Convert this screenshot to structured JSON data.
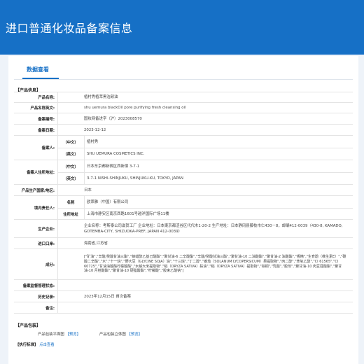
{
  "header": {
    "title": "进口普通化妆品备案信息"
  },
  "tab": {
    "label": "数据查看"
  },
  "product_info": {
    "section_label": "【产品信息】",
    "rows": {
      "name_cn": {
        "label": "产品名称:",
        "value": "植村秀植萃黑洁颜油"
      },
      "name_en": {
        "label": "产品名称英文:",
        "value": "shu uemura blackOil pore purifying fresh cleansing oil"
      },
      "record_no": {
        "label": "备案编号:",
        "value": "国妆网备进字（沪）2023008570"
      },
      "record_date": {
        "label": "备案日期:",
        "value": "2023-12-12"
      },
      "filer": {
        "label": "备案人:",
        "sub_cn": "（中文）",
        "value_cn": "植村秀",
        "sub_en": "（英文）",
        "value_en": "SHU UEMURA COSMETICS INC."
      },
      "filer_address": {
        "label": "备案人住所地址:",
        "sub_cn": "（中文）",
        "value_cn": "日本东京都新宿区西新宿 3-7-1",
        "sub_en": "（英文）",
        "value_en": "3-7-1 NISHI-SHINJUKU, SHINJUKU-KU, TOKYO, JAPAN"
      },
      "origin": {
        "label": "产品生产国家/地区:",
        "value": "日本"
      },
      "domestic_agent": {
        "label": "境内责任人:",
        "sub_name": "名称",
        "value_name": "欧莱雅（中国）有限公司",
        "sub_address": "住所地址",
        "value_address": "上海市静安区南京西路1601号越洋国际广场11楼"
      },
      "producer": {
        "label": "生产企业:",
        "value": "企业名称：考斯泰公司滋贺工厂 企业地址：日本東京都涩谷区代代木1-20-2 生产地址：日本静冈县藤枝市仁430－8，邮编412-0039（430-8, KAMADO, GOTEMBA-CITY, SHIZUOKA-PREF, JAPAN 412-0039）"
      },
      "port": {
        "label": "进口口岸:",
        "value": "海南省,江苏省"
      },
      "ingredients": {
        "label": "成分:",
        "value": "[\"矿油\",\"辛酸/癸酸甘油三酯\",\"鲸蜡醇乙基己酸酯\",\"聚甘油-6 二辛酸酯\",\"辛酸/癸酸甘油三酯\",\"聚甘油-10 二油酸酯\",\"聚甘油-2 油酸酯\",\"香精\",\"生育酚（维生素E）\",\"碳酸二辛酯\",\"水\",\"十一烷\",\"野大豆（GLYCINE SOJA）油\",\"十三烷\",\"丁二醇\",\"番茄（SOLANUM LYCOPERSICUM）果提取物\",\"丙二醇\",\"苯氧乙醇\",\"CI 61565\",\"CI 60725\",\"甘油油酸酯柠檬酸酯\",\"水解大米提取物\",\"稻（ORYZA SATIVA）麸油\",\"稻（ORYZA SATIVA）提取物\",\"棕榈\",\"乳酸\",\"胶剂\",\"聚甘油-10 肉豆蔻酸酯\",\"聚甘油-10 月桂酸酯\",\"聚甘油-10 硬脂酸酯\",\"柠檬酸\",\"胶束乙酸钠\"]"
      },
      "inspection": {
        "label": "备案监督管理状态:",
        "value": ""
      },
      "history": {
        "label": "历史记录:",
        "value": "2023年12月15日 首次备案"
      },
      "remarks": {
        "label": "备注:",
        "value": ""
      }
    }
  },
  "packaging": {
    "section_label": "【产品包装】",
    "flat_label": "产品包装平面图",
    "flat_link": "【预览】",
    "solid_label": "产品包装立体图",
    "solid_link": "【预览】"
  },
  "standard": {
    "section_label": "【执行标准】",
    "link": "点击查看"
  }
}
